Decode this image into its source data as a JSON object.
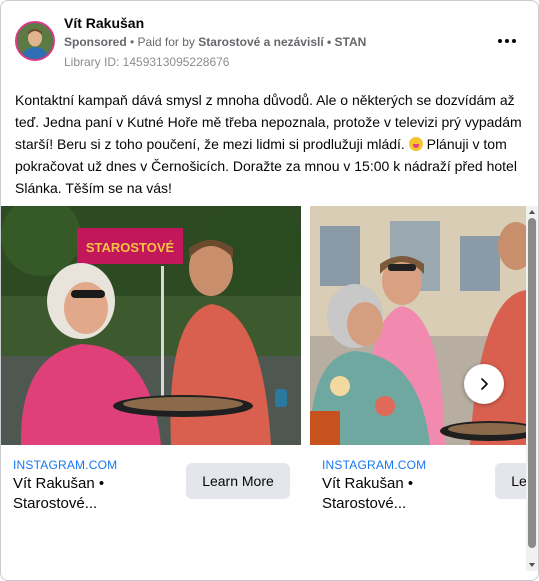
{
  "post": {
    "page_name": "Vít Rakušan",
    "sponsored": "Sponsored",
    "paid_for_prefix": "• Paid for by",
    "payer": "Starostové a nezávislí • STAN",
    "library_id": "Library ID: 1459313095228676",
    "text_line_1": "Kontaktní kampaň dává smysl z mnoha důvodů. Ale o některých se dozvídám až teď. Jedna paní v Kutné Hoře mě třeba nepoznala, protože v televizi prý vypadám starší! Beru si z toho poučení, že mezi lidmi si prodlužuji mládí.",
    "text_line_2": "Plánuji v tom pokračovat už dnes v Černošicích. Doražte za mnou v 15:00 k nádraží před hotel Slánka. Těším se na vás!"
  },
  "carousel": {
    "cards": [
      {
        "domain": "INSTAGRAM.COM",
        "title_line1": "Vít Rakušan •",
        "title_line2": "Starostové...",
        "button": "Learn More",
        "sign_text": "STAROSTOVÉ"
      },
      {
        "domain": "INSTAGRAM.COM",
        "title_line1": "Vít Rakušan •",
        "title_line2": "Starostové...",
        "button": "Learn More"
      }
    ]
  },
  "icons": {
    "more": "more-dots-icon",
    "next": "chevron-right-icon",
    "emoji": "grinning-emoji-icon"
  },
  "colors": {
    "link_blue": "#1877f2",
    "meta_gray": "#65676b",
    "button_gray": "#e4e6eb",
    "sign_magenta": "#c2185b"
  }
}
